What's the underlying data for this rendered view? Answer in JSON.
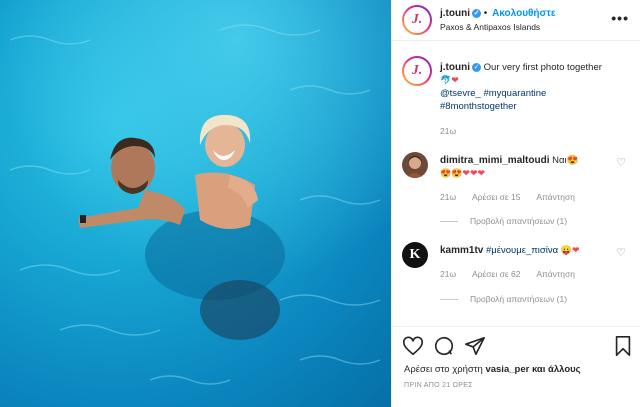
{
  "post": {
    "username": "j.touni",
    "follow_label": "Ακολουθήστε",
    "location": "Paxos & Antipaxos Islands",
    "more_label": "•••"
  },
  "caption": {
    "username": "j.touni",
    "text": "Our very first photo together",
    "emoji_fish": "🐬",
    "emoji_heart": "❤",
    "mention": "@tsevre_",
    "hashtag1": "#myquarantine",
    "hashtag2": "#8monthstogether",
    "time": "21ω"
  },
  "comments": [
    {
      "username": "dimitra_mimi_maltoudi",
      "text": "Ναι",
      "emoji_line1": "😍",
      "emoji_line2": "😍😍❤❤❤",
      "time": "21ω",
      "likes": "Αρέσει σε 15",
      "reply": "Απάντηση",
      "view_replies": "Προβολή απαντήσεων (1)"
    },
    {
      "username": "kamm1tv",
      "hashtag": "#μένουμε_πισίνα",
      "emoji": "😛❤",
      "avatar_letter": "K",
      "time": "21ω",
      "likes": "Αρέσει σε 62",
      "reply": "Απάντηση",
      "view_replies": "Προβολή απαντήσεων (1)"
    }
  ],
  "footer": {
    "liked_by_prefix": "Αρέσει στο χρήστη",
    "liked_by_user": "vasia_per",
    "liked_by_suffix": "και άλλους",
    "posted_ago": "ΠΡΙΝ ΑΠΟ 21 ΩΡΕΣ"
  },
  "icons": {
    "like": "heart-outline-icon",
    "comment": "comment-bubble-icon",
    "share": "paper-plane-icon",
    "save": "bookmark-icon"
  },
  "colors": {
    "link": "#00376b",
    "follow": "#0095f6",
    "muted": "#8e8e8e",
    "water": "#17a7d3"
  }
}
